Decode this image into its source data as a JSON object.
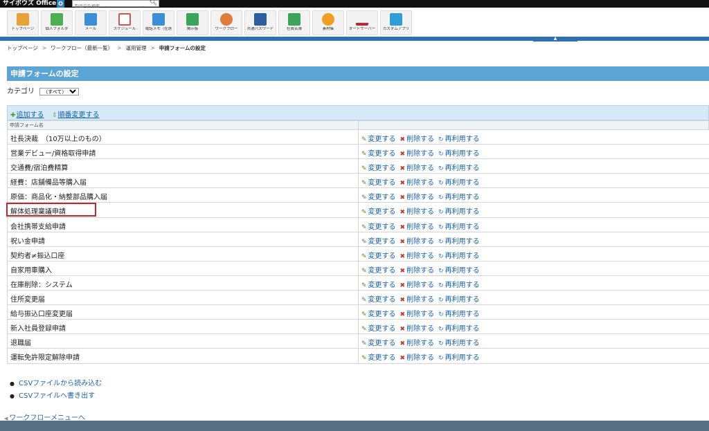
{
  "topbar": {
    "logo_text": "サイボウズ Office",
    "search_placeholder": "製品内を検索"
  },
  "apps": [
    {
      "label": "トップページ",
      "icon": "home-icon",
      "color": "#e8a23a"
    },
    {
      "label": "個人フォルダ",
      "icon": "folder-icon",
      "color": "#4caf50"
    },
    {
      "label": "メール",
      "icon": "mail-icon",
      "color": "#3a8fd6"
    },
    {
      "label": "スケジュール",
      "icon": "calendar-icon",
      "color": "#d9534f"
    },
    {
      "label": "電話メモ（在席",
      "icon": "phone-memo-icon",
      "color": "#3a8fd6"
    },
    {
      "label": "掲示板",
      "icon": "board-icon",
      "color": "#3ba55c"
    },
    {
      "label": "ワークフロー",
      "icon": "workflow-icon",
      "color": "#e07b39"
    },
    {
      "label": "共通パスワード",
      "icon": "password-icon",
      "color": "#2d5fa0"
    },
    {
      "label": "社員名簿",
      "icon": "directory-icon",
      "color": "#3ba55c"
    },
    {
      "label": "素材集",
      "icon": "pie-icon",
      "color": "#f0a020"
    },
    {
      "label": "オートサーバー",
      "icon": "server-icon",
      "color": "#c0282e"
    },
    {
      "label": "カスタムアプリ",
      "icon": "custom-app-icon",
      "color": "#2e9fd6"
    }
  ],
  "breadcrumb": {
    "items": [
      "トップページ",
      "ワークフロー（最新一覧）",
      "運用管理"
    ],
    "current": "申請フォームの設定"
  },
  "page_title": "申請フォームの設定",
  "category": {
    "label": "カテゴリ",
    "selected": "（すべて）"
  },
  "toolbar": {
    "add_label": "追加する",
    "reorder_label": "順番変更する"
  },
  "table": {
    "header_name": "申請フォーム名",
    "action_edit": "変更する",
    "action_delete": "削除する",
    "action_reuse": "再利用する",
    "rows": [
      "社長決裁　（10万以上のもの）",
      "営業デビュー/資格取得申請",
      "交通費/宿泊費精算",
      "経費：店舗備品等購入届",
      "原価：商品化・納整部品購入届",
      "解体処理稟議申請",
      "会社携帯支給申請",
      "祝い金申請",
      "契約者≠振込口座",
      "自家用車購入",
      "在庫削除：システム",
      "住所変更届",
      "給与振込口座変更届",
      "新入社員登録申請",
      "退職届",
      "運転免許限定解除申請"
    ]
  },
  "links": {
    "csv_import": "CSVファイルから読み込む",
    "csv_export": "CSVファイルへ書き出す",
    "back": "ワークフローメニューへ"
  }
}
